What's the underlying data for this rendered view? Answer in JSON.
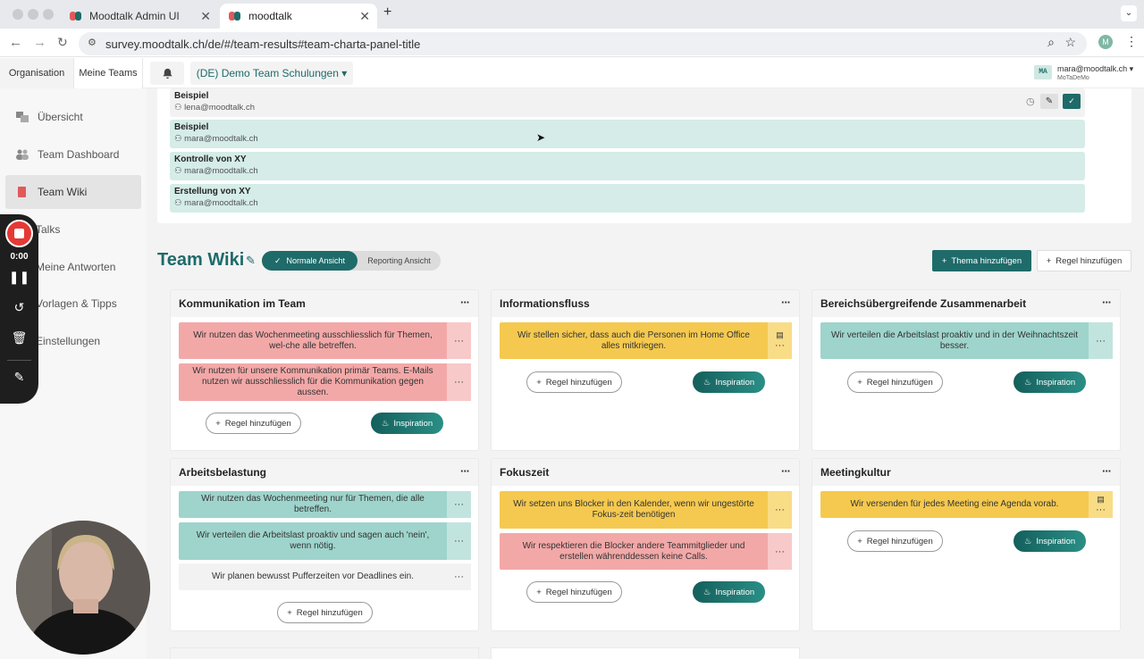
{
  "browser": {
    "tabs": [
      {
        "title": "Moodtalk Admin UI"
      },
      {
        "title": "moodtalk"
      }
    ],
    "url": "survey.moodtalk.ch/de/#/team-results#team-charta-panel-title",
    "new_tab": "+",
    "profile": "M"
  },
  "header": {
    "tabs": [
      {
        "label": "Organisation"
      },
      {
        "label": "Meine Teams"
      }
    ],
    "team_select": "(DE) Demo Team Schulungen ▾",
    "user_initials": "MA",
    "user_email": "mara@moodtalk.ch ▾",
    "user_org": "MoTaDeMo"
  },
  "sidebar": {
    "items": [
      {
        "label": "Übersicht"
      },
      {
        "label": "Team Dashboard"
      },
      {
        "label": "Team Wiki"
      },
      {
        "label": "Talks"
      },
      {
        "label": "Meine Antworten"
      },
      {
        "label": "Vorlagen & Tipps"
      },
      {
        "label": "Einstellungen"
      }
    ]
  },
  "recorder": {
    "time": "0:00"
  },
  "panel_rows": [
    {
      "title": "Beispiel",
      "email": "lena@moodtalk.ch"
    },
    {
      "title": "Beispiel",
      "email": "mara@moodtalk.ch"
    },
    {
      "title": "Kontrolle von XY",
      "email": "mara@moodtalk.ch"
    },
    {
      "title": "Erstellung von XY",
      "email": "mara@moodtalk.ch"
    }
  ],
  "wiki": {
    "title": "Team Wiki",
    "view_normal": "Normale Ansicht",
    "view_reporting": "Reporting Ansicht",
    "add_topic": "Thema hinzufügen",
    "add_rule": "Regel hinzufügen"
  },
  "card_actions": {
    "add_rule": "Regel hinzufügen",
    "inspiration": "Inspiration",
    "more": "···"
  },
  "cards": [
    {
      "title": "Kommunikation im Team",
      "rules": [
        {
          "text": "Wir nutzen das Wochenmeeting ausschliesslich für Themen, wel-che alle betreffen."
        },
        {
          "text": "Wir nutzen für unsere Kommunikation primär Teams. E-Mails nutzen wir ausschliesslich für die Kommunikation gegen aussen."
        }
      ]
    },
    {
      "title": "Informationsfluss",
      "rules": [
        {
          "text": "Wir stellen sicher, dass auch die Personen im Home Office alles mitkriegen."
        }
      ]
    },
    {
      "title": "Bereichsübergreifende Zusammenarbeit",
      "rules": [
        {
          "text": "Wir verteilen die Arbeitslast proaktiv und in der Weihnachtszeit besser."
        }
      ]
    },
    {
      "title": "Arbeitsbelastung",
      "rules": [
        {
          "text": "Wir nutzen das Wochenmeeting nur für Themen, die alle betreffen."
        },
        {
          "text": "Wir verteilen die Arbeitslast proaktiv und sagen auch 'nein', wenn nötig."
        },
        {
          "text": "Wir planen bewusst Pufferzeiten vor Deadlines ein."
        }
      ]
    },
    {
      "title": "Fokuszeit",
      "rules": [
        {
          "text": "Wir setzen uns Blocker in den Kalender, wenn wir ungestörte Fokus-zeit benötigen"
        },
        {
          "text": "Wir respektieren die Blocker andere Teammitglieder und erstellen währenddessen keine Calls."
        }
      ]
    },
    {
      "title": "Meetingkultur",
      "rules": [
        {
          "text": "Wir versenden für jedes Meeting eine Agenda vorab."
        }
      ]
    }
  ],
  "colors": {
    "brand": "#1e6b6a",
    "red_rule": "#f3a8a8",
    "yellow_rule": "#f5c94f",
    "teal_rule": "#9ed4cc"
  }
}
